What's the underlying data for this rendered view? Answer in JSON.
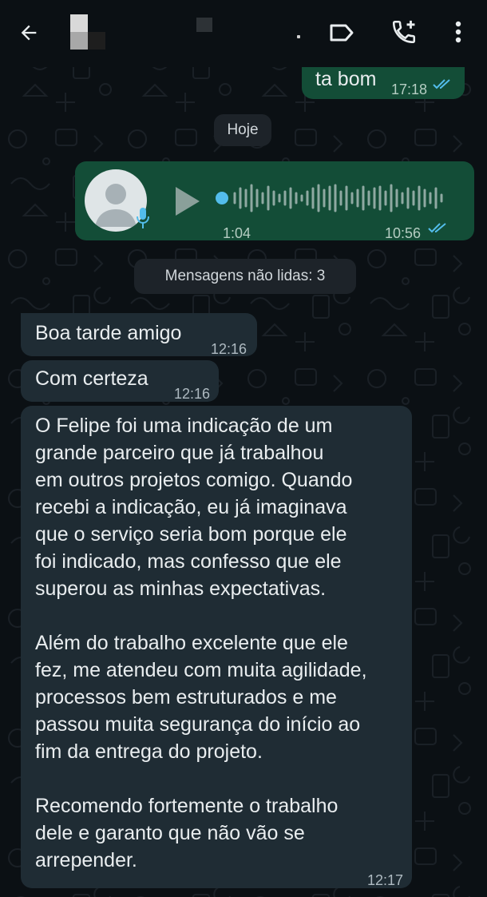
{
  "header": {
    "back_icon": "arrow-left-icon",
    "label_icon": "label-tag-icon",
    "call_icon": "add-call-icon",
    "menu_icon": "more-vertical-icon"
  },
  "messages": {
    "top_out": {
      "text": "ta bom",
      "time": "17:18",
      "status": "read"
    },
    "date_separator": "Hoje",
    "voice": {
      "duration": "1:04",
      "time": "10:56",
      "status": "read"
    },
    "unread_banner": "Mensagens não lidas: 3",
    "in1": {
      "text": "Boa tarde amigo",
      "time": "12:16"
    },
    "in2": {
      "text": "Com certeza",
      "time": "12:16"
    },
    "in3": {
      "text": "O Felipe foi uma indicação de um\ngrande parceiro que já trabalhou\nem outros projetos comigo. Quando\nrecebi a indicação, eu já imaginava\nque o serviço seria bom porque ele\nfoi indicado, mas confesso que ele\nsuperou as minhas expectativas.\n\nAlém do trabalho excelente que ele\nfez, me atendeu com muita agilidade,\nprocessos bem estruturados e me\npassou muita segurança do início ao\nfim da entrega do projeto.\n\nRecomendo fortemente o trabalho\ndele e garanto que não vão se\narrepender.",
      "time": "12:17"
    }
  },
  "colors": {
    "background": "#0b1014",
    "outgoing_bubble": "#134d37",
    "incoming_bubble": "#1f2c34",
    "read_ticks": "#53bdeb"
  }
}
